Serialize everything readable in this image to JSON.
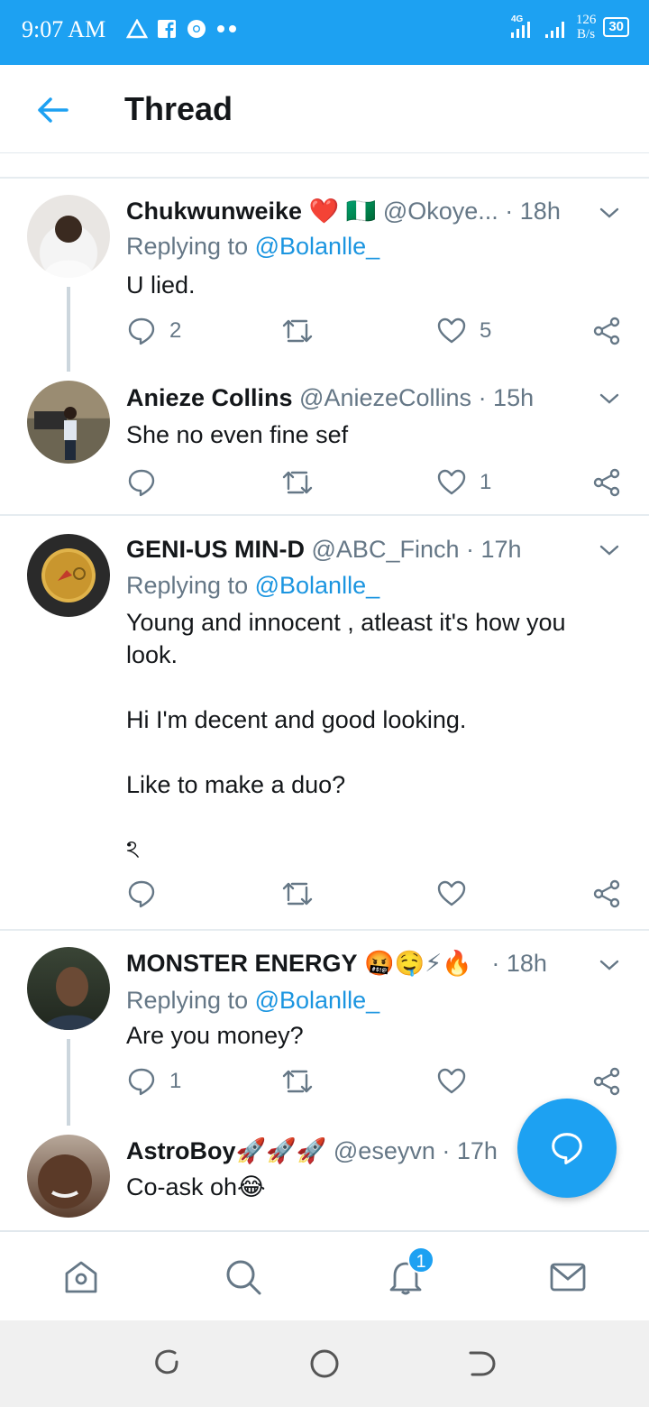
{
  "status_bar": {
    "time": "9:07 AM",
    "network": "4G",
    "speed_value": "126",
    "speed_unit": "B/s",
    "battery": "30"
  },
  "header": {
    "title": "Thread"
  },
  "tweets": [
    {
      "name": "Chukwunweike",
      "name_emoji": "❤️ 🇳🇬",
      "handle": "@Okoye...",
      "time": "· 18h",
      "replying_label": "Replying to",
      "replying_handle": "@Bolanlle_",
      "text": "U lied.",
      "replies": "2",
      "retweets": "",
      "likes": "5"
    },
    {
      "name": "Anieze Collins",
      "name_emoji": "",
      "handle": "@AniezeCollins",
      "time": "· 15h",
      "text": "She no even fine sef",
      "replies": "",
      "retweets": "",
      "likes": "1"
    },
    {
      "name": "GENI-US MIN-D",
      "name_emoji": "",
      "handle": "@ABC_Finch",
      "time": "· 17h",
      "replying_label": "Replying to",
      "replying_handle": "@Bolanlle_",
      "text_lines": [
        "Young and innocent , atleast it's how you look.",
        "Hi I'm decent and good looking.",
        "Like to make a duo?",
        "ঽ"
      ],
      "replies": "",
      "retweets": "",
      "likes": ""
    },
    {
      "name": "MONSTER ENERGY",
      "name_emoji": "🤬🤤⚡🔥",
      "handle": "",
      "time": "· 18h",
      "replying_label": "Replying to",
      "replying_handle": "@Bolanlle_",
      "text": "Are you money?",
      "replies": "1",
      "retweets": "",
      "likes": ""
    },
    {
      "name": "AstroBoy",
      "name_emoji": "🚀🚀🚀",
      "handle": "@eseyvn",
      "time": "· 17h",
      "text": "Co-ask oh😂"
    }
  ],
  "bottom_nav": {
    "notifications_badge": "1"
  },
  "colors": {
    "brand": "#1da1f2",
    "link": "#1b95e0",
    "muted": "#657786",
    "text": "#14171a"
  }
}
